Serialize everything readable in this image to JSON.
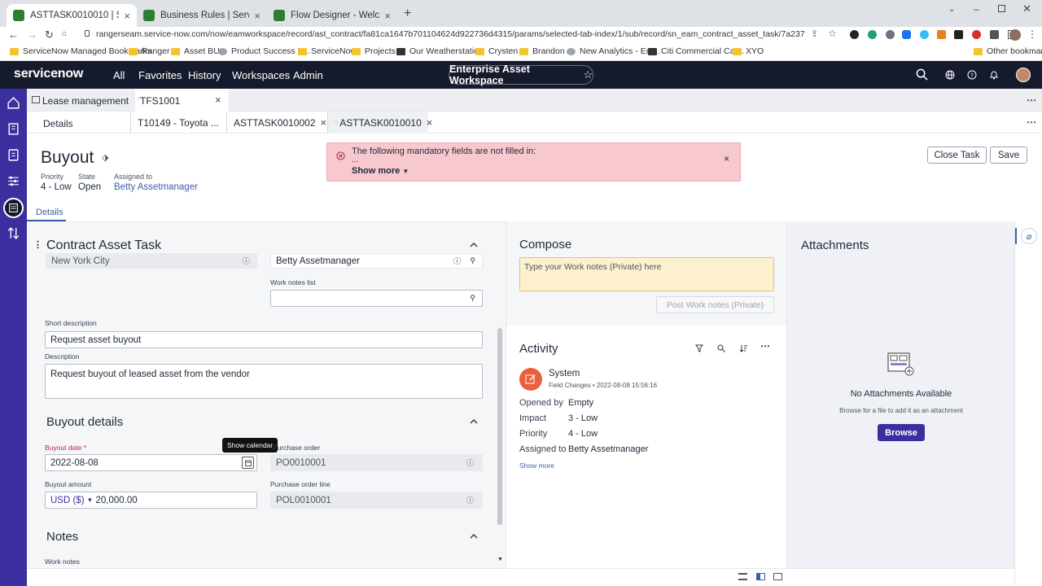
{
  "browser": {
    "tabs": [
      {
        "title": "ASTTASK0010010 | ServiceNow",
        "active": true
      },
      {
        "title": "Business Rules | ServiceNow",
        "active": false
      },
      {
        "title": "Flow Designer - Welcome",
        "active": false
      }
    ],
    "url": "rangerseam.service-now.com/now/eamworkspace/record/ast_contract/fa81ca1647b701104624d922736d4315/params/selected-tab-index/1/sub/record/sn_eam_contract_asset_task/7a237c0c871911109c0d99b...",
    "bookmarks": [
      "ServiceNow Managed Bookmarks",
      "Ranger",
      "Asset BU",
      "Product Success V...",
      "ServiceNow",
      "Projects",
      "Our Weatherstation",
      "Crysten",
      "Brandon",
      "New Analytics - Em...",
      "Citi Commercial Car...",
      "XYO"
    ],
    "other_bookmarks": "Other bookmarks"
  },
  "header": {
    "logo": "servicenow",
    "nav": [
      "All",
      "Favorites",
      "History",
      "Workspaces",
      "Admin"
    ],
    "workspace": "Enterprise Asset Workspace"
  },
  "tabs": {
    "primary": [
      {
        "label": "Lease management",
        "active": false
      },
      {
        "label": "TFS1001",
        "active": true
      }
    ],
    "secondary": [
      {
        "label": "Details"
      },
      {
        "label": "T10149 - Toyota ..."
      },
      {
        "label": "ASTTASK0010002"
      },
      {
        "label": "ASTTASK0010010"
      }
    ]
  },
  "record": {
    "title": "Buyout",
    "priority_label": "Priority",
    "priority": "4 - Low",
    "state_label": "State",
    "state": "Open",
    "assigned_label": "Assigned to",
    "assigned": "Betty Assetmanager",
    "details_tab": "Details",
    "close_task": "Close Task",
    "save": "Save"
  },
  "alert": {
    "message": "The following mandatory fields are not filled in:",
    "ellipsis": "...",
    "show_more": "Show more"
  },
  "form": {
    "section_title": "Contract Asset Task",
    "location": "New York City",
    "assigned_to": "Betty Assetmanager",
    "work_notes_list_label": "Work notes list",
    "short_desc_label": "Short description",
    "short_desc": "Request asset buyout",
    "desc_label": "Description",
    "desc": "Request buyout of leased asset from the vendor",
    "buyout_section": "Buyout details",
    "buyout_date_label": "Buyout date",
    "buyout_date": "2022-08-08",
    "tooltip": "Show calendar",
    "po_label": "Purchase order",
    "po": "PO0010001",
    "amount_label": "Buyout amount",
    "currency": "USD ($)",
    "amount": "20,000.00",
    "po_line_label": "Purchase order line",
    "po_line": "POL0010001",
    "notes_section": "Notes",
    "work_notes_label": "Work notes"
  },
  "compose": {
    "title": "Compose",
    "placeholder": "Type your Work notes (Private) here",
    "post_button": "Post Work notes (Private)"
  },
  "activity": {
    "title": "Activity",
    "author": "System",
    "type": "Field Changes",
    "timestamp": "2022-08-08 15:56:16",
    "changes": [
      {
        "field": "Opened by",
        "value": "Empty"
      },
      {
        "field": "Impact",
        "value": "3 - Low"
      },
      {
        "field": "Priority",
        "value": "4 - Low"
      },
      {
        "field": "Assigned to",
        "value": "Betty Assetmanager"
      }
    ],
    "show_more": "Show more"
  },
  "attachments": {
    "title": "Attachments",
    "empty_title": "No Attachments Available",
    "empty_sub": "Browse for a file to add it as an attachment",
    "browse": "Browse"
  },
  "colors": {
    "header_bg": "#151b2c",
    "rail_bg": "#3b2f9f",
    "alert_bg": "#f8c8cf",
    "accent": "#3b2f9f",
    "required": "#c2185b"
  }
}
